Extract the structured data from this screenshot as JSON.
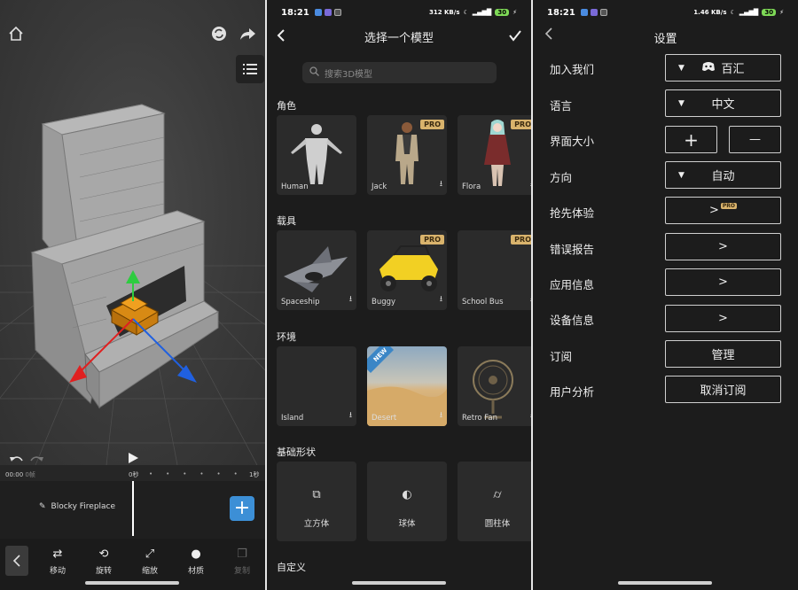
{
  "editor": {
    "timeline": {
      "start_time": "00:00",
      "start_suffix": "0帧",
      "mark_0": "0秒",
      "mark_1": "1秒"
    },
    "track_label": "Blocky Fireplace",
    "add_label": "+",
    "tools": [
      {
        "label": "移动",
        "icon": "move-icon"
      },
      {
        "label": "旋转",
        "icon": "rotate-icon"
      },
      {
        "label": "缩放",
        "icon": "scale-icon"
      },
      {
        "label": "材质",
        "icon": "material-icon"
      },
      {
        "label": "复制",
        "icon": "copy-icon"
      }
    ]
  },
  "status_bar": {
    "time": "18:21",
    "speed": "312 KB/s",
    "battery": "30"
  },
  "status_bar_p3": {
    "time": "18:21",
    "speed": "1.46 KB/s",
    "battery": "30"
  },
  "picker": {
    "title": "选择一个模型",
    "search_placeholder": "搜索3D模型",
    "sections": [
      {
        "title": "角色",
        "items": [
          {
            "label": "Human",
            "pro": false
          },
          {
            "label": "Jack",
            "pro": true
          },
          {
            "label": "Flora",
            "pro": true
          }
        ]
      },
      {
        "title": "载具",
        "items": [
          {
            "label": "Spaceship",
            "pro": false
          },
          {
            "label": "Buggy",
            "pro": true
          },
          {
            "label": "School Bus",
            "pro": true
          }
        ]
      },
      {
        "title": "环境",
        "items": [
          {
            "label": "Island",
            "pro": false
          },
          {
            "label": "Desert",
            "badge": "NEW"
          },
          {
            "label": "Retro Fan",
            "pro": false
          }
        ]
      },
      {
        "title": "基础形状",
        "items": [
          {
            "label": "立方体"
          },
          {
            "label": "球体"
          },
          {
            "label": "圆柱体"
          }
        ]
      },
      {
        "title": "自定义"
      }
    ],
    "pro_label": "PRO",
    "colors": {
      "pro_badge": "#d9b36c",
      "new_badge": "#3b86c6"
    }
  },
  "settings": {
    "title": "设置",
    "rows": [
      {
        "label": "加入我们",
        "value": "百汇"
      },
      {
        "label": "语言",
        "value": "中文"
      },
      {
        "label": "界面大小",
        "plus": "+",
        "minus": "—"
      },
      {
        "label": "方向",
        "value": "自动"
      },
      {
        "label": "抢先体验",
        "value": ">",
        "pro": "PRO"
      },
      {
        "label": "错误报告",
        "value": ">"
      },
      {
        "label": "应用信息",
        "value": ">"
      },
      {
        "label": "设备信息",
        "value": ">"
      },
      {
        "label": "订阅",
        "value": "管理"
      },
      {
        "label": "用户分析",
        "value": "取消订阅"
      }
    ]
  }
}
